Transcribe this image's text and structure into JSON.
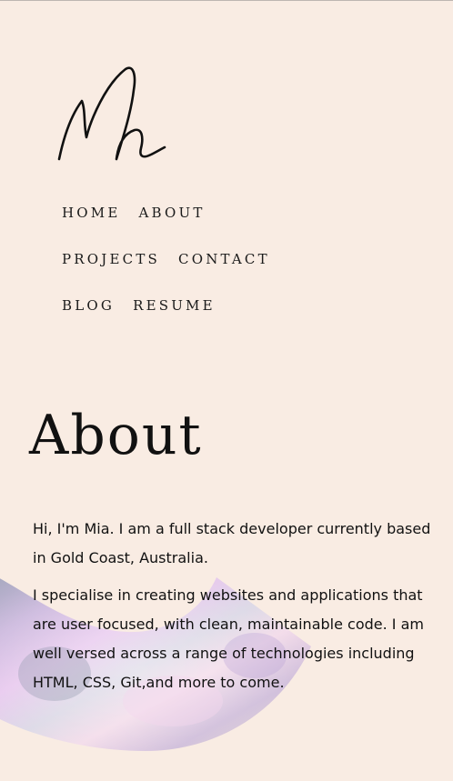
{
  "nav": {
    "row1": [
      "HOME",
      "ABOUT"
    ],
    "row2": [
      "PROJECTS",
      "CONTACT"
    ],
    "row3": [
      "BLOG",
      "RESUME"
    ]
  },
  "about": {
    "title": "About",
    "paragraph1": "Hi, I'm Mia. I am a full stack developer currently based in Gold Coast, Australia.",
    "paragraph2": "I specialise in creating websites and applications that are user focused, with clean, maintainable code. I am well versed across a range of technologies including HTML, CSS, Git,and more to come."
  },
  "colors": {
    "background": "#f9ece3",
    "text": "#111111"
  },
  "icons": {
    "logo": "signature-logo-icon",
    "decoration": "holographic-arc-decoration"
  }
}
